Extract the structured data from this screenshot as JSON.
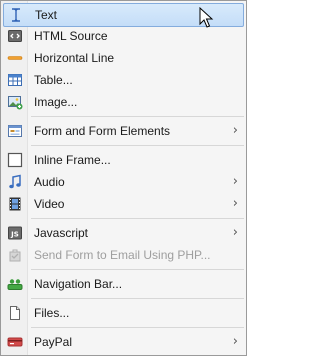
{
  "menu": {
    "items": [
      {
        "label": "Text",
        "icon": "text-cursor-icon"
      },
      {
        "label": "HTML Source",
        "icon": "html-source-icon"
      },
      {
        "label": "Horizontal Line",
        "icon": "horizontal-line-icon"
      },
      {
        "label": "Table...",
        "icon": "table-icon"
      },
      {
        "label": "Image...",
        "icon": "image-icon"
      },
      {
        "label": "Form and Form Elements",
        "icon": "form-icon",
        "submenu": true
      },
      {
        "label": "Inline Frame...",
        "icon": "inline-frame-icon"
      },
      {
        "label": "Audio",
        "icon": "audio-note-icon",
        "submenu": true
      },
      {
        "label": "Video",
        "icon": "video-film-icon",
        "submenu": true
      },
      {
        "label": "Javascript",
        "icon": "javascript-icon",
        "submenu": true
      },
      {
        "label": "Send Form to Email Using PHP...",
        "icon": "send-email-icon",
        "disabled": true
      },
      {
        "label": "Navigation Bar...",
        "icon": "navigation-bar-icon"
      },
      {
        "label": "Files...",
        "icon": "file-icon"
      },
      {
        "label": "PayPal",
        "icon": "paypal-icon",
        "submenu": true
      }
    ],
    "submenu_arrow": "›",
    "highlight_color": "#c9e0f8"
  }
}
